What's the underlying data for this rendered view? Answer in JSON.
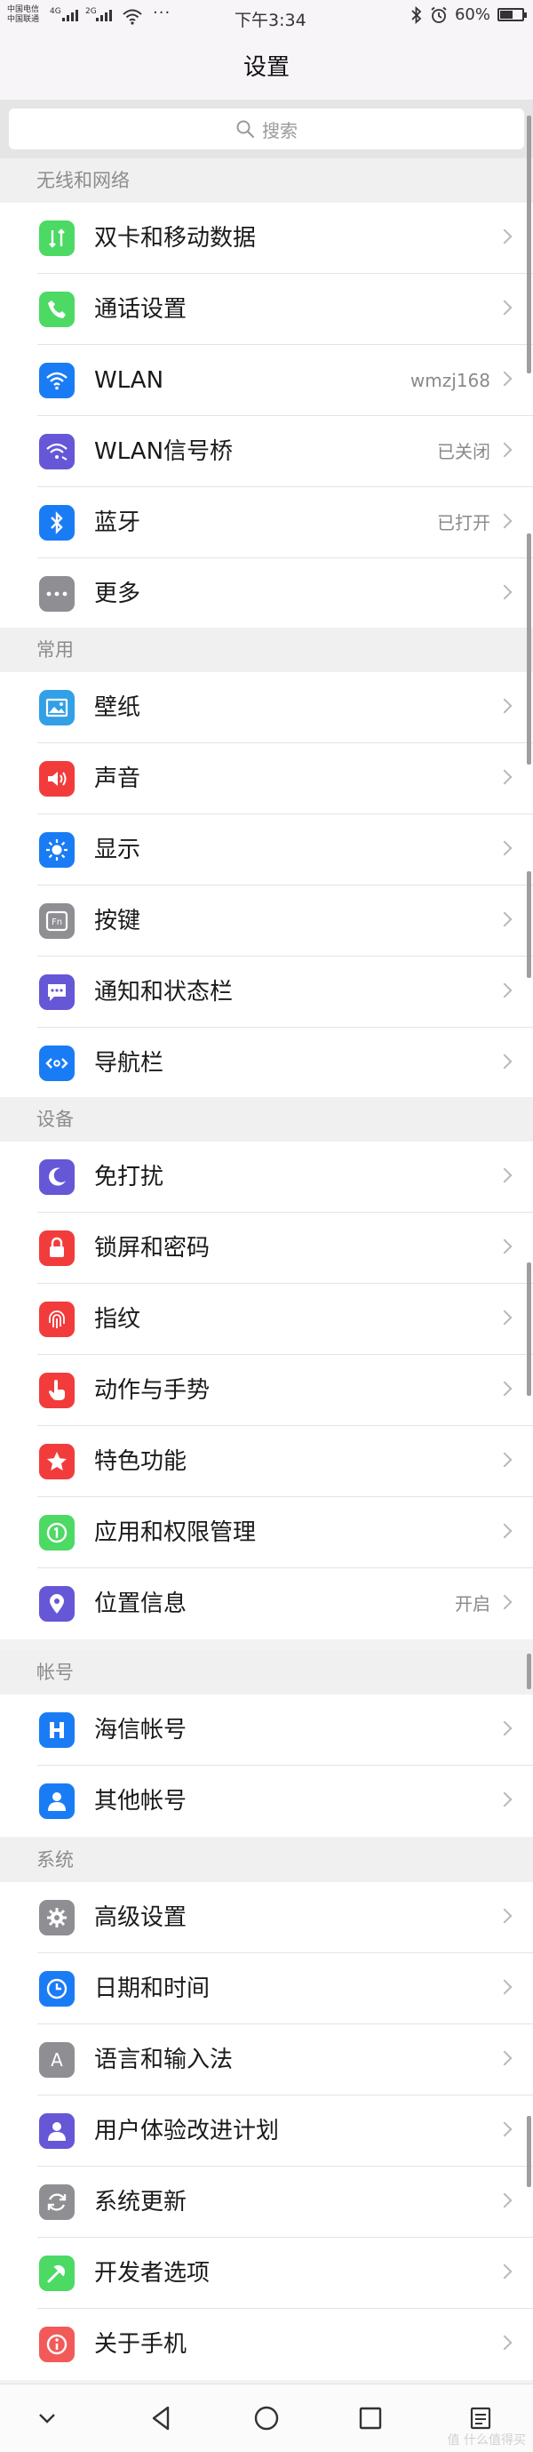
{
  "status_bar": {
    "carrier1": "中国电信",
    "carrier2": "中国联通",
    "net1": "4G",
    "net2": "2G",
    "more": "···",
    "time": "下午3:34",
    "battery_text": "60%",
    "battery_level": 0.6
  },
  "header": {
    "title": "设置"
  },
  "search": {
    "placeholder": "搜索"
  },
  "sections": [
    {
      "title": "无线和网络",
      "items": [
        {
          "label": "双卡和移动数据",
          "value": "",
          "icon": "dual-sim-icon",
          "color": "#4cd964"
        },
        {
          "label": "通话设置",
          "value": "",
          "icon": "phone-icon",
          "color": "#4cd964"
        },
        {
          "label": "WLAN",
          "value": "wmzj168",
          "icon": "wifi-icon",
          "color": "#1a7cf5"
        },
        {
          "label": "WLAN信号桥",
          "value": "已关闭",
          "icon": "wifi-bridge-icon",
          "color": "#6657d7"
        },
        {
          "label": "蓝牙",
          "value": "已打开",
          "icon": "bluetooth-icon",
          "color": "#1a7cf5"
        },
        {
          "label": "更多",
          "value": "",
          "icon": "more-icon",
          "color": "#8e8e93"
        }
      ]
    },
    {
      "title": "常用",
      "items": [
        {
          "label": "壁纸",
          "value": "",
          "icon": "wallpaper-icon",
          "color": "#32a0e6"
        },
        {
          "label": "声音",
          "value": "",
          "icon": "sound-icon",
          "color": "#f23c3c"
        },
        {
          "label": "显示",
          "value": "",
          "icon": "brightness-icon",
          "color": "#1a7cf5"
        },
        {
          "label": "按键",
          "value": "",
          "icon": "fn-key-icon",
          "color": "#8e8e93"
        },
        {
          "label": "通知和状态栏",
          "value": "",
          "icon": "notification-icon",
          "color": "#6657d7"
        },
        {
          "label": "导航栏",
          "value": "",
          "icon": "navigation-bar-icon",
          "color": "#1a7cf5"
        }
      ]
    },
    {
      "title": "设备",
      "items": [
        {
          "label": "免打扰",
          "value": "",
          "icon": "moon-icon",
          "color": "#6657d7"
        },
        {
          "label": "锁屏和密码",
          "value": "",
          "icon": "lock-icon",
          "color": "#f23c3c"
        },
        {
          "label": "指纹",
          "value": "",
          "icon": "fingerprint-icon",
          "color": "#f23c3c"
        },
        {
          "label": "动作与手势",
          "value": "",
          "icon": "gesture-icon",
          "color": "#f23c3c"
        },
        {
          "label": "特色功能",
          "value": "",
          "icon": "star-icon",
          "color": "#f23c3c"
        },
        {
          "label": "应用和权限管理",
          "value": "",
          "icon": "app-permission-icon",
          "color": "#4cd964"
        },
        {
          "label": "位置信息",
          "value": "开启",
          "icon": "location-icon",
          "color": "#6657d7"
        }
      ]
    },
    {
      "title": "帐号",
      "items": [
        {
          "label": "海信帐号",
          "value": "",
          "icon": "hisense-icon",
          "color": "#1a7cf5"
        },
        {
          "label": "其他帐号",
          "value": "",
          "icon": "person-icon",
          "color": "#1a7cf5"
        }
      ]
    },
    {
      "title": "系统",
      "items": [
        {
          "label": "高级设置",
          "value": "",
          "icon": "gear-icon",
          "color": "#8e8e93"
        },
        {
          "label": "日期和时间",
          "value": "",
          "icon": "clock-icon",
          "color": "#1a7cf5"
        },
        {
          "label": "语言和输入法",
          "value": "",
          "icon": "language-icon",
          "color": "#8e8e93"
        },
        {
          "label": "用户体验改进计划",
          "value": "",
          "icon": "user-experience-icon",
          "color": "#6657d7"
        },
        {
          "label": "系统更新",
          "value": "",
          "icon": "update-icon",
          "color": "#8e8e93"
        },
        {
          "label": "开发者选项",
          "value": "",
          "icon": "developer-icon",
          "color": "#4cd964"
        },
        {
          "label": "关于手机",
          "value": "",
          "icon": "info-icon",
          "color": "#f25a5a"
        }
      ]
    }
  ],
  "nav_bar": {
    "buttons": [
      "collapse-icon",
      "back-icon",
      "home-icon",
      "recents-icon",
      "menu-icon"
    ],
    "watermark": "值 什么值得买"
  }
}
